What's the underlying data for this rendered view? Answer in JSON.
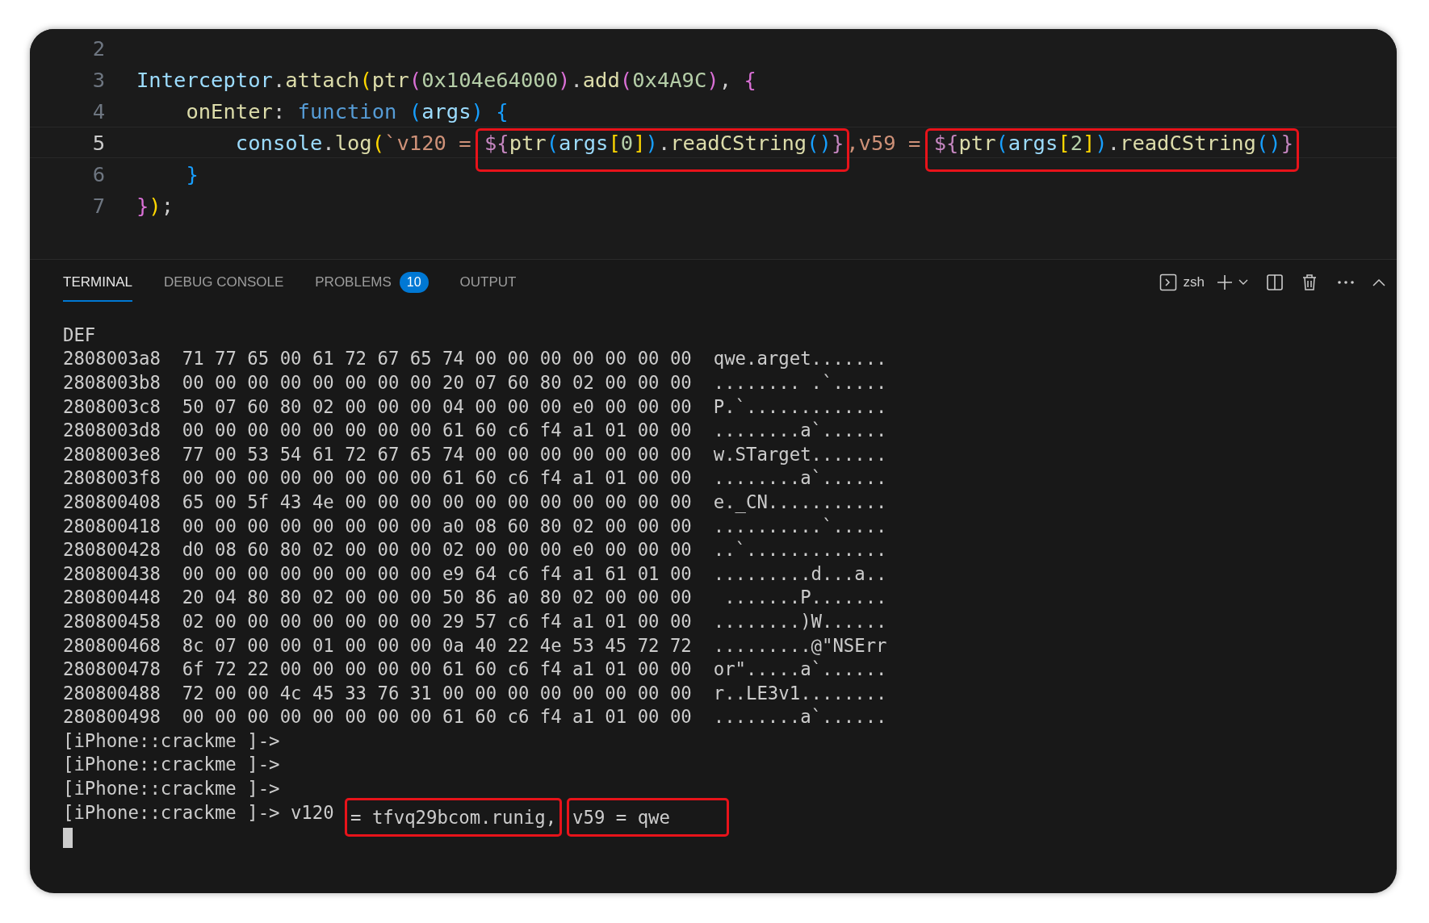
{
  "editor": {
    "lines": [
      {
        "number": "2",
        "current": false
      },
      {
        "number": "3",
        "current": false,
        "parts": [
          {
            "boxed": false,
            "tokens": [
              {
                "text": "Interceptor",
                "kind": "variable"
              },
              {
                "text": ".",
                "kind": "plain"
              },
              {
                "text": "attach",
                "kind": "function"
              },
              {
                "text": "(",
                "kind": "bracket1"
              },
              {
                "text": "ptr",
                "kind": "function"
              },
              {
                "text": "(",
                "kind": "bracket2"
              },
              {
                "text": "0x104e64000",
                "kind": "number"
              },
              {
                "text": ")",
                "kind": "bracket2"
              },
              {
                "text": ".",
                "kind": "plain"
              },
              {
                "text": "add",
                "kind": "function"
              },
              {
                "text": "(",
                "kind": "bracket2"
              },
              {
                "text": "0x4A9C",
                "kind": "number"
              },
              {
                "text": ")",
                "kind": "bracket2"
              },
              {
                "text": ", ",
                "kind": "plain"
              },
              {
                "text": "{",
                "kind": "bracket2"
              }
            ]
          }
        ]
      },
      {
        "number": "4",
        "current": false,
        "parts": [
          {
            "boxed": false,
            "tokens": [
              {
                "text": "    onEnter",
                "kind": "function"
              },
              {
                "text": ": ",
                "kind": "plain"
              },
              {
                "text": "function ",
                "kind": "keyword"
              },
              {
                "text": "(",
                "kind": "bracket3"
              },
              {
                "text": "args",
                "kind": "variable"
              },
              {
                "text": ") {",
                "kind": "bracket3"
              }
            ]
          }
        ]
      },
      {
        "number": "5",
        "current": true,
        "parts": [
          {
            "boxed": false,
            "tokens": [
              {
                "text": "        console",
                "kind": "variable"
              },
              {
                "text": ".",
                "kind": "plain"
              },
              {
                "text": "log",
                "kind": "function"
              },
              {
                "text": "(",
                "kind": "bracket1"
              },
              {
                "text": "`v120 = ",
                "kind": "string"
              }
            ]
          },
          {
            "boxed": true,
            "tokens": [
              {
                "text": "${",
                "kind": "template"
              },
              {
                "text": "ptr",
                "kind": "function"
              },
              {
                "text": "(",
                "kind": "bracket3"
              },
              {
                "text": "args",
                "kind": "variable"
              },
              {
                "text": "[",
                "kind": "bracket1"
              },
              {
                "text": "0",
                "kind": "number"
              },
              {
                "text": "]",
                "kind": "bracket1"
              },
              {
                "text": ")",
                "kind": "bracket3"
              },
              {
                "text": ".",
                "kind": "plain"
              },
              {
                "text": "readCString",
                "kind": "function"
              },
              {
                "text": "()",
                "kind": "bracket3"
              },
              {
                "text": "}",
                "kind": "template"
              }
            ]
          },
          {
            "boxed": false,
            "tokens": [
              {
                "text": ",v59 = ",
                "kind": "string"
              }
            ]
          },
          {
            "boxed": true,
            "tokens": [
              {
                "text": "${",
                "kind": "template"
              },
              {
                "text": "ptr",
                "kind": "function"
              },
              {
                "text": "(",
                "kind": "bracket3"
              },
              {
                "text": "args",
                "kind": "variable"
              },
              {
                "text": "[",
                "kind": "bracket1"
              },
              {
                "text": "2",
                "kind": "number"
              },
              {
                "text": "]",
                "kind": "bracket1"
              },
              {
                "text": ")",
                "kind": "bracket3"
              },
              {
                "text": ".",
                "kind": "plain"
              },
              {
                "text": "readCString",
                "kind": "function"
              },
              {
                "text": "()",
                "kind": "bracket3"
              },
              {
                "text": "}",
                "kind": "template"
              }
            ]
          }
        ]
      },
      {
        "number": "6",
        "current": false,
        "parts": [
          {
            "boxed": false,
            "tokens": [
              {
                "text": "    }",
                "kind": "bracket3"
              }
            ]
          }
        ]
      },
      {
        "number": "7",
        "current": false,
        "parts": [
          {
            "boxed": false,
            "tokens": [
              {
                "text": "}",
                "kind": "bracket2"
              },
              {
                "text": ")",
                "kind": "bracket1"
              },
              {
                "text": ";",
                "kind": "plain"
              }
            ]
          }
        ]
      }
    ]
  },
  "panel": {
    "tabs": [
      {
        "label": "TERMINAL",
        "selected": true
      },
      {
        "label": "DEBUG CONSOLE",
        "selected": false
      },
      {
        "label": "PROBLEMS",
        "selected": false,
        "badge": "10"
      },
      {
        "label": "OUTPUT",
        "selected": false
      }
    ],
    "shell": "zsh"
  },
  "terminal": {
    "heading": "DEF",
    "rows": [
      {
        "address": "2808003a8",
        "bytes": "71 77 65 00 61 72 67 65 74 00 00 00 00 00 00 00",
        "ascii": "qwe.arget......."
      },
      {
        "address": "2808003b8",
        "bytes": "00 00 00 00 00 00 00 00 20 07 60 80 02 00 00 00",
        "ascii": "........ .`....."
      },
      {
        "address": "2808003c8",
        "bytes": "50 07 60 80 02 00 00 00 04 00 00 00 e0 00 00 00",
        "ascii": "P.`............."
      },
      {
        "address": "2808003d8",
        "bytes": "00 00 00 00 00 00 00 00 61 60 c6 f4 a1 01 00 00",
        "ascii": "........a`......"
      },
      {
        "address": "2808003e8",
        "bytes": "77 00 53 54 61 72 67 65 74 00 00 00 00 00 00 00",
        "ascii": "w.STarget......."
      },
      {
        "address": "2808003f8",
        "bytes": "00 00 00 00 00 00 00 00 61 60 c6 f4 a1 01 00 00",
        "ascii": "........a`......"
      },
      {
        "address": "280800408",
        "bytes": "65 00 5f 43 4e 00 00 00 00 00 00 00 00 00 00 00",
        "ascii": "e._CN..........."
      },
      {
        "address": "280800418",
        "bytes": "00 00 00 00 00 00 00 00 a0 08 60 80 02 00 00 00",
        "ascii": "..........`....."
      },
      {
        "address": "280800428",
        "bytes": "d0 08 60 80 02 00 00 00 02 00 00 00 e0 00 00 00",
        "ascii": "..`............."
      },
      {
        "address": "280800438",
        "bytes": "00 00 00 00 00 00 00 00 e9 64 c6 f4 a1 61 01 00",
        "ascii": ".........d...a.."
      },
      {
        "address": "280800448",
        "bytes": "20 04 80 80 02 00 00 00 50 86 a0 80 02 00 00 00",
        "ascii": " .......P......."
      },
      {
        "address": "280800458",
        "bytes": "02 00 00 00 00 00 00 00 29 57 c6 f4 a1 01 00 00",
        "ascii": "........)W......"
      },
      {
        "address": "280800468",
        "bytes": "8c 07 00 00 01 00 00 00 0a 40 22 4e 53 45 72 72",
        "ascii": ".........@\"NSErr"
      },
      {
        "address": "280800478",
        "bytes": "6f 72 22 00 00 00 00 00 61 60 c6 f4 a1 01 00 00",
        "ascii": "or\".....a`......"
      },
      {
        "address": "280800488",
        "bytes": "72 00 00 4c 45 33 76 31 00 00 00 00 00 00 00 00",
        "ascii": "r..LE3v1........"
      },
      {
        "address": "280800498",
        "bytes": "00 00 00 00 00 00 00 00 61 60 c6 f4 a1 01 00 00",
        "ascii": "........a`......"
      }
    ],
    "prompts": [
      {
        "parts": [
          {
            "boxed": false,
            "text": "[iPhone::crackme ]->"
          }
        ]
      },
      {
        "parts": [
          {
            "boxed": false,
            "text": "[iPhone::crackme ]->"
          }
        ]
      },
      {
        "parts": [
          {
            "boxed": false,
            "text": "[iPhone::crackme ]->"
          }
        ]
      },
      {
        "parts": [
          {
            "boxed": false,
            "text": "[iPhone::crackme ]-> v120 "
          },
          {
            "boxed": true,
            "text": "= tfvq29bcom.runig,"
          },
          {
            "boxed": true,
            "text": "v59 = qwe"
          }
        ]
      }
    ]
  }
}
